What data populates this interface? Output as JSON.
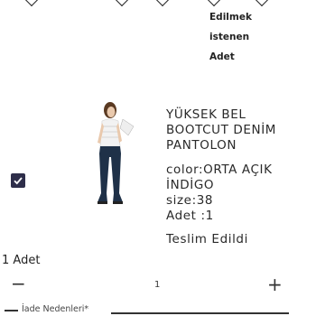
{
  "order_table": {
    "headers": {
      "delivered_line1": "Edilmek",
      "delivered_line2": "istenen",
      "delivered_line3": "Adet"
    }
  },
  "product": {
    "name_line1": "YÜKSEK BEL",
    "name_line2": "BOOTCUT DENİM",
    "name_line3": "PANTOLON",
    "color_line1": "color:ORTA AÇIK",
    "color_line2": "İNDİGO",
    "size": "size:38",
    "quantity": "Adet :1",
    "status": "Teslim Edildi",
    "selected": true
  },
  "quantity_selector": {
    "label": "1 Adet",
    "decrement_symbol": "−",
    "value": "1",
    "increment_symbol": "+"
  },
  "return_reason": {
    "label": "İade Nedenleri*"
  },
  "colors": {
    "checkbox_bg": "#2e2e4a",
    "text": "#2a2a2a"
  }
}
